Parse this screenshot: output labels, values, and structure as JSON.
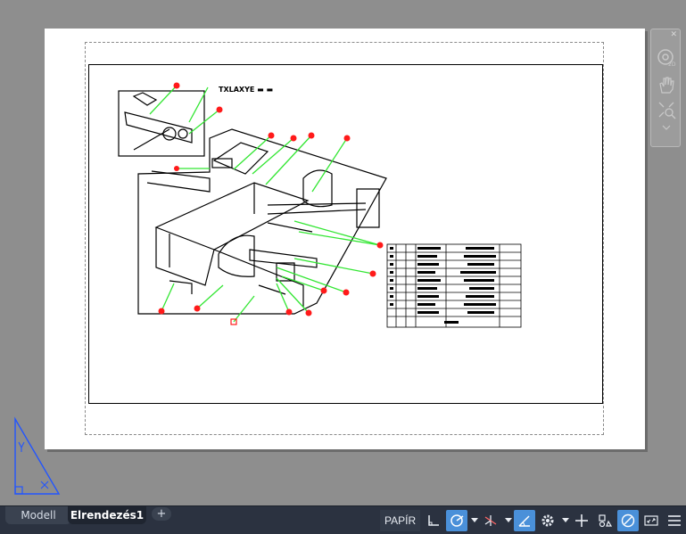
{
  "layout_tabs": [
    {
      "label": "Modell"
    },
    {
      "label": "Elrendezés1"
    }
  ],
  "add_tab_label": "+",
  "status": {
    "paper_label": "PAPÍR"
  },
  "drawing": {
    "title_note": "TXLAXYE ▬ ▬"
  },
  "colors": {
    "canvas_bg": "#8e8e8e",
    "status_bg": "#2b3240",
    "active_accent": "#4a90d9",
    "leader_green": "#33e633",
    "balloon_red": "#ff1a1a"
  },
  "navbar": {
    "tools": [
      "steering-wheel-icon",
      "pan-icon",
      "zoom-extents-icon"
    ]
  }
}
